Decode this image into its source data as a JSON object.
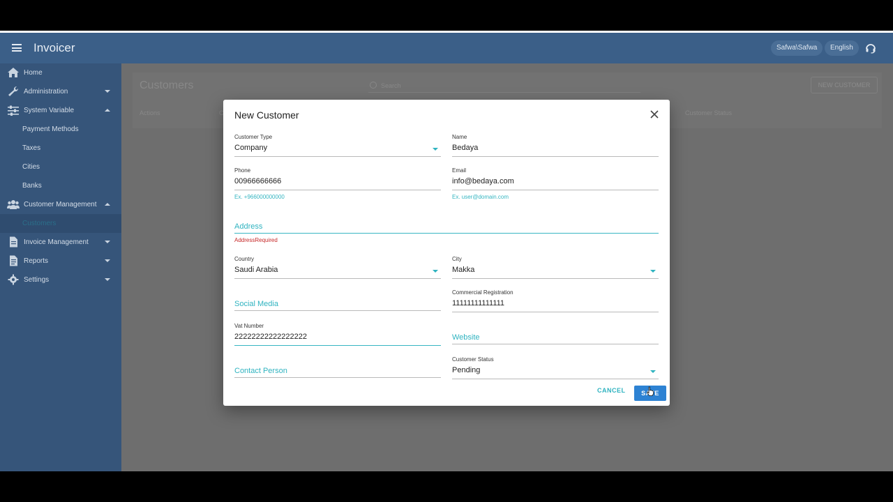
{
  "app": {
    "title": "Invoicer",
    "user": "Safwa\\Safwa",
    "language": "English"
  },
  "sidebar": {
    "items": [
      {
        "label": "Home",
        "icon": "home-icon"
      },
      {
        "label": "Administration",
        "icon": "wrench-icon"
      },
      {
        "label": "System Variable",
        "icon": "sliders-icon"
      },
      {
        "label": "Payment Methods"
      },
      {
        "label": "Taxes"
      },
      {
        "label": "Cities"
      },
      {
        "label": "Banks"
      },
      {
        "label": "Customer Management",
        "icon": "users-icon"
      },
      {
        "label": "Customers"
      },
      {
        "label": "Invoice Management",
        "icon": "document-icon"
      },
      {
        "label": "Reports",
        "icon": "report-icon"
      },
      {
        "label": "Settings",
        "icon": "gear-icon"
      }
    ]
  },
  "page": {
    "title": "Customers",
    "search_placeholder": "Search",
    "new_customer_label": "NEW CUSTOMER",
    "columns": [
      "Actions",
      "C",
      "Customer Status"
    ]
  },
  "dialog": {
    "title": "New Customer",
    "fields": {
      "customer_type": {
        "label": "Customer Type",
        "value": "Company"
      },
      "name": {
        "label": "Name",
        "value": "Bedaya"
      },
      "phone": {
        "label": "Phone",
        "value": "00966666666",
        "hint": "Ex. +966000000000"
      },
      "email": {
        "label": "Email",
        "value": "info@bedaya.com",
        "hint": "Ex. user@domain.com"
      },
      "address": {
        "placeholder": "Address",
        "error": "AddressRequired"
      },
      "country": {
        "label": "Country",
        "value": "Saudi Arabia"
      },
      "city": {
        "label": "City",
        "value": "Makka"
      },
      "social_media": {
        "placeholder": "Social Media"
      },
      "commercial_registration": {
        "label": "Commercial Registration",
        "value": "11111111111111"
      },
      "vat_number": {
        "label": "Vat Number",
        "value": "22222222222222222"
      },
      "website": {
        "placeholder": "Website"
      },
      "contact_person": {
        "placeholder": "Contact Person"
      },
      "customer_status": {
        "label": "Customer Status",
        "value": "Pending"
      }
    },
    "cancel_label": "CANCEL",
    "save_label": "SAVE"
  },
  "colors": {
    "appbar": "#3b5f88",
    "sidebar": "#36557a",
    "accent": "#2fb3c0",
    "primary_button": "#2d82d3",
    "error": "#c62828"
  }
}
